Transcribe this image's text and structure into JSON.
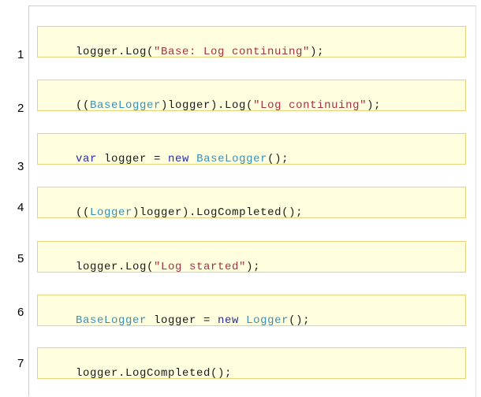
{
  "colors": {
    "box_background": "#ffffe0",
    "box_border": "#e6d27a",
    "keyword": "#2a2aa8",
    "type": "#3a8fb8",
    "string": "#a33145",
    "plain": "#1a1a1a"
  },
  "rows": [
    {
      "number": "1",
      "tokens": [
        {
          "text": "logger.Log(",
          "kind": "plain"
        },
        {
          "text": "\"Base: Log continuing\"",
          "kind": "str"
        },
        {
          "text": ");",
          "kind": "plain"
        }
      ]
    },
    {
      "number": "2",
      "tokens": [
        {
          "text": "((",
          "kind": "plain"
        },
        {
          "text": "BaseLogger",
          "kind": "type"
        },
        {
          "text": ")logger).Log(",
          "kind": "plain"
        },
        {
          "text": "\"Log continuing\"",
          "kind": "str"
        },
        {
          "text": ");",
          "kind": "plain"
        }
      ]
    },
    {
      "number": "3",
      "tokens": [
        {
          "text": "var",
          "kind": "kw"
        },
        {
          "text": " logger = ",
          "kind": "plain"
        },
        {
          "text": "new",
          "kind": "kw"
        },
        {
          "text": " ",
          "kind": "plain"
        },
        {
          "text": "BaseLogger",
          "kind": "type"
        },
        {
          "text": "();",
          "kind": "plain"
        }
      ]
    },
    {
      "number": "4",
      "tokens": [
        {
          "text": "((",
          "kind": "plain"
        },
        {
          "text": "Logger",
          "kind": "type"
        },
        {
          "text": ")logger).LogCompleted();",
          "kind": "plain"
        }
      ]
    },
    {
      "number": "5",
      "tokens": [
        {
          "text": "logger.Log(",
          "kind": "plain"
        },
        {
          "text": "\"Log started\"",
          "kind": "str"
        },
        {
          "text": ");",
          "kind": "plain"
        }
      ]
    },
    {
      "number": "6",
      "tokens": [
        {
          "text": "BaseLogger",
          "kind": "type"
        },
        {
          "text": " logger = ",
          "kind": "plain"
        },
        {
          "text": "new",
          "kind": "kw"
        },
        {
          "text": " ",
          "kind": "plain"
        },
        {
          "text": "Logger",
          "kind": "type"
        },
        {
          "text": "();",
          "kind": "plain"
        }
      ]
    },
    {
      "number": "7",
      "tokens": [
        {
          "text": "logger.LogCompleted();",
          "kind": "plain"
        }
      ]
    }
  ]
}
